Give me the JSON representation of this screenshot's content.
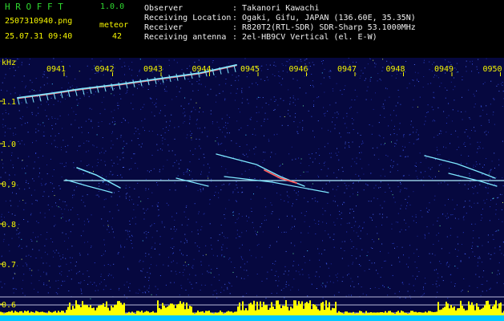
{
  "app": {
    "name": "H R O F F T",
    "version": "1.0.0"
  },
  "file": {
    "name": "2507310940.png",
    "datetime": "25.07.31 09:40"
  },
  "meteor": {
    "label": "meteor",
    "count": "42"
  },
  "info": {
    "rows": [
      {
        "label": "Observer",
        "value": ": Takanori Kawachi"
      },
      {
        "label": "Receiving Location",
        "value": ": Ogaki, Gifu, JAPAN (136.60E, 35.35N)"
      },
      {
        "label": "Receiver",
        "value": ": R820T2(RTL-SDR) SDR-Sharp 53.1000MHz"
      },
      {
        "label": "Receiving antenna",
        "value": ": 2el-HB9CV Vertical (el. E-W)"
      }
    ]
  },
  "spectrogram": {
    "y_unit": "kHz",
    "y_ticks": [
      "1.1",
      "1.0",
      "0.9",
      "0.8",
      "0.7",
      "0.6"
    ],
    "x_ticks": [
      "0941",
      "0942",
      "0943",
      "0944",
      "0945",
      "0946",
      "0947",
      "0948",
      "0949",
      "0950"
    ],
    "colors": {
      "background": "#06083f",
      "noise": "#2a3cc8",
      "meteor": "#7ee8ff",
      "hot": "#ff6060",
      "carrier": "#b0f0ff",
      "level_bars": "#ffff00",
      "level_base": "#00c8ff"
    }
  }
}
